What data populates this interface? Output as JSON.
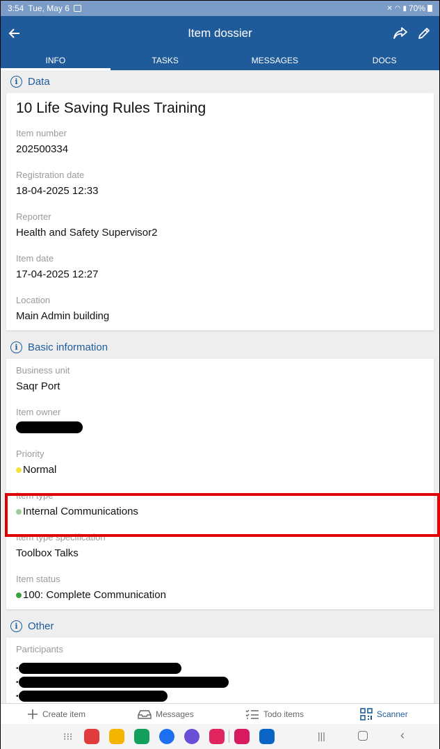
{
  "status_bar": {
    "time": "3:54",
    "date": "Tue, May 6",
    "battery": "70%"
  },
  "app_bar": {
    "title": "Item dossier"
  },
  "tabs": [
    {
      "label": "INFO",
      "active": true
    },
    {
      "label": "TASKS",
      "active": false
    },
    {
      "label": "MESSAGES",
      "active": false
    },
    {
      "label": "DOCS",
      "active": false
    }
  ],
  "data_section": {
    "header": "Data",
    "item_title": "10 Life Saving Rules Training",
    "fields": [
      {
        "label": "Item number",
        "value": "202500334"
      },
      {
        "label": "Registration date",
        "value": "18-04-2025 12:33"
      },
      {
        "label": "Reporter",
        "value": "Health and Safety Supervisor2"
      },
      {
        "label": "Item date",
        "value": "17-04-2025 12:27"
      },
      {
        "label": "Location",
        "value": "Main Admin building"
      }
    ]
  },
  "basic_section": {
    "header": "Basic information",
    "business_unit": {
      "label": "Business unit",
      "value": "Saqr Port"
    },
    "item_owner": {
      "label": "Item owner"
    },
    "priority": {
      "label": "Priority",
      "value": "Normal",
      "dot_color": "#f2e23a"
    },
    "item_type": {
      "label": "Item type",
      "value": "Internal Communications",
      "dot_color": "#9ccf9a"
    },
    "item_type_spec": {
      "label": "Item type specification",
      "value": "Toolbox Talks"
    },
    "item_status": {
      "label": "Item status",
      "value": "100: Complete Communication",
      "dot_color": "#3aa046"
    }
  },
  "other_section": {
    "header": "Other",
    "participants_label": "Participants"
  },
  "bottom_nav": {
    "create": "Create item",
    "messages": "Messages",
    "todo": "Todo items",
    "scanner": "Scanner"
  },
  "colors": {
    "primary": "#1f5b9a",
    "highlight": "#e00000"
  }
}
